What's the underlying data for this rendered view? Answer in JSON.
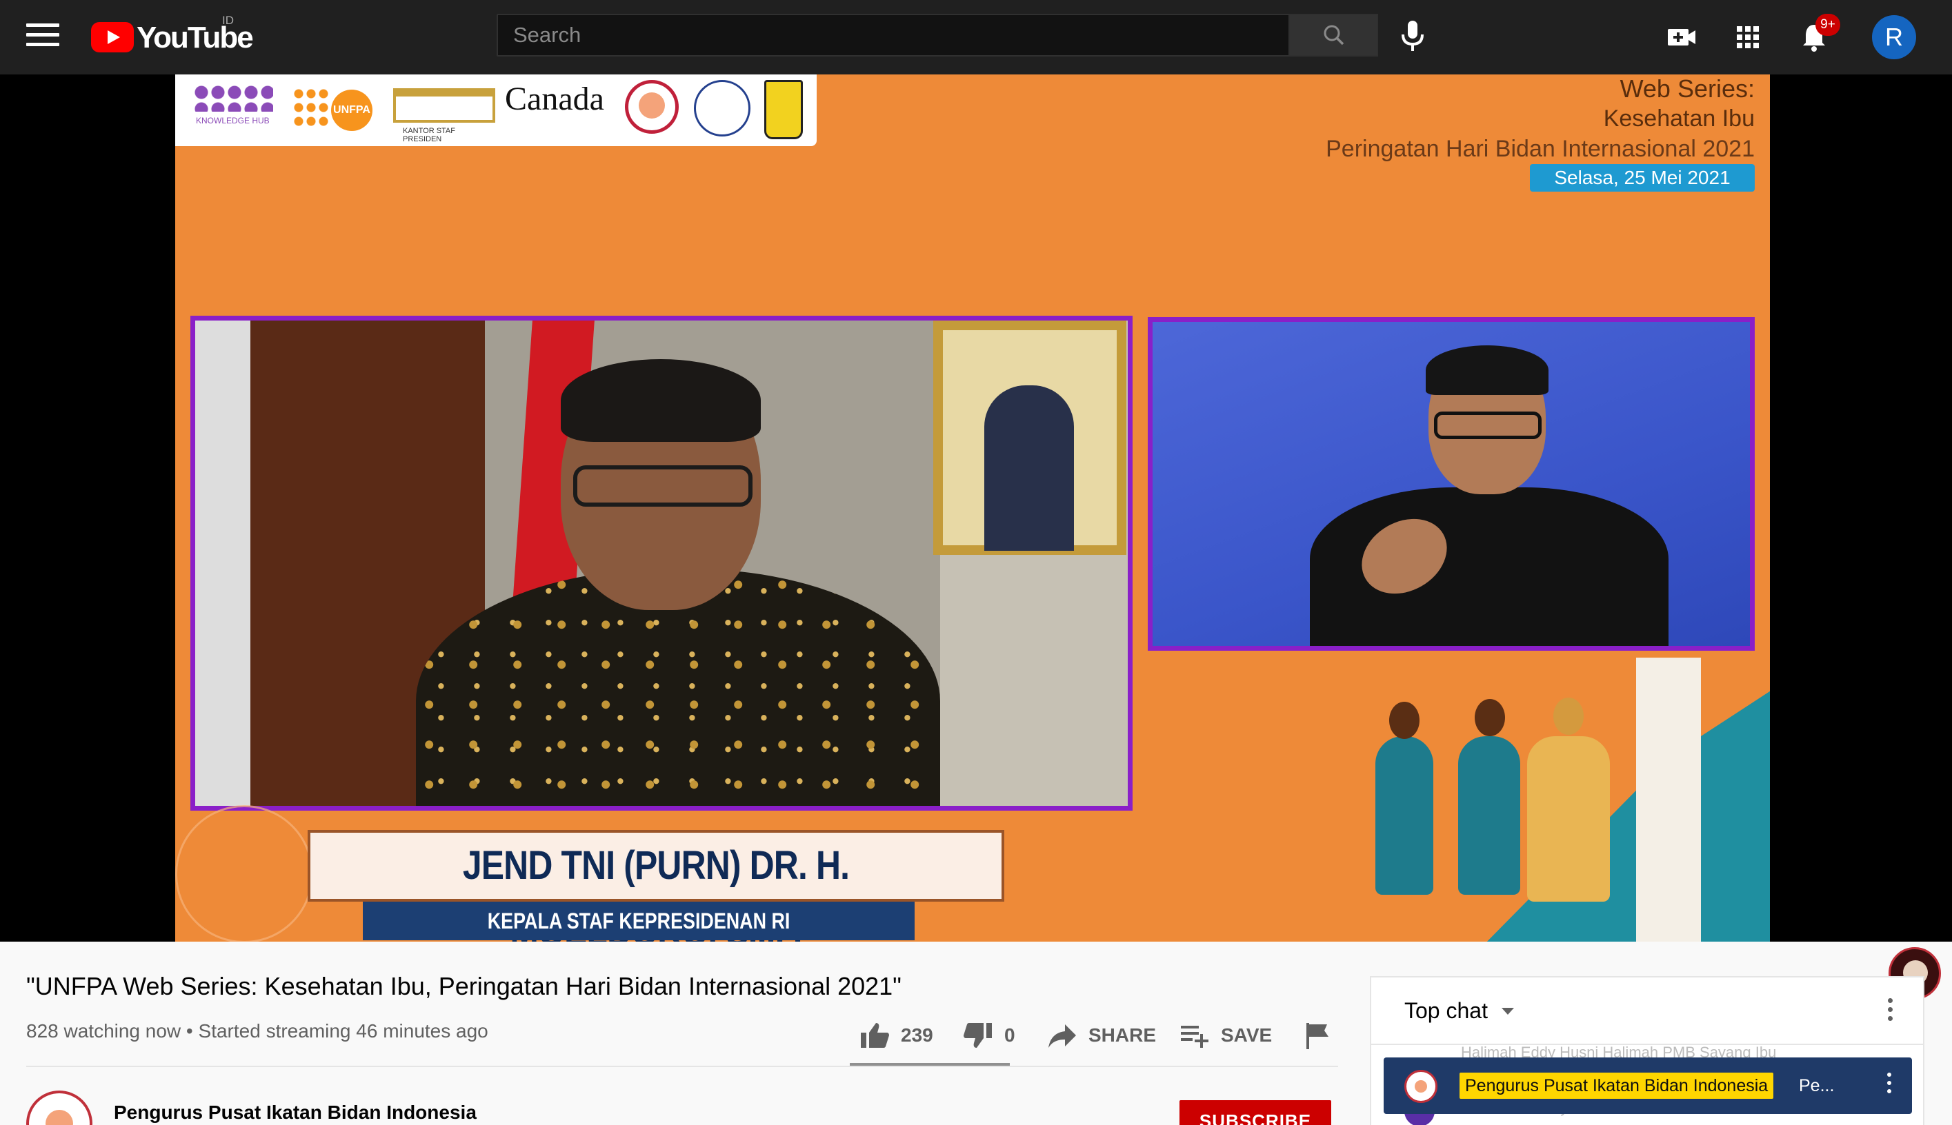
{
  "header": {
    "logo_text": "YouTube",
    "country_code": "ID",
    "search_placeholder": "Search",
    "notification_count": "9+",
    "avatar_initial": "R"
  },
  "video": {
    "overlay": {
      "series_line1": "Web Series:",
      "series_line2": "Kesehatan Ibu",
      "series_line3": "Peringatan Hari Bidan Internasional 2021",
      "date": "Selasa, 25 Mei 2021",
      "partner_canada": "Canada",
      "partner_unfpa": "UNFPA",
      "speaker_name": "JEND TNI (PURN) DR. H. MOELDOKO, S.I.P.",
      "speaker_title": "KEPALA STAF KEPRESIDENAN RI"
    },
    "title": "\"UNFPA Web Series: Kesehatan Ibu, Peringatan Hari Bidan Internasional 2021\"",
    "meta": "828 watching now • Started streaming 46 minutes ago"
  },
  "actions": {
    "likes": "239",
    "dislikes": "0",
    "share_label": "SHARE",
    "save_label": "SAVE"
  },
  "channel": {
    "name": "Pengurus Pusat Ikatan Bidan Indonesia",
    "subscribe_label": "SUBSCRIBE"
  },
  "chat": {
    "mode_label": "Top chat",
    "faded_line_1": "Halimah Eddy  Husni Halimah PMB Sayang Ibu",
    "faded_line_2": "Simanik Nurhayati  PC IBI KOTA BEKASI",
    "pinned_author": "Pengurus Pusat Ikatan Bidan Indonesia",
    "pinned_message": "Pe..."
  },
  "colors": {
    "masthead": "#202020",
    "brand_red": "#ff0000",
    "subscribe_red": "#cc0000",
    "frame_orange": "#ee8a38",
    "frame_border_purple": "#8a1fc8",
    "pinned_bg": "#1f3a68",
    "pinned_author_highlight": "#ffd600"
  },
  "icons": [
    "menu-icon",
    "youtube-logo-icon",
    "search-icon",
    "microphone-icon",
    "create-video-icon",
    "apps-grid-icon",
    "notifications-bell-icon",
    "thumb-up-icon",
    "thumb-down-icon",
    "share-arrow-icon",
    "playlist-add-icon",
    "flag-icon",
    "more-vert-icon"
  ]
}
